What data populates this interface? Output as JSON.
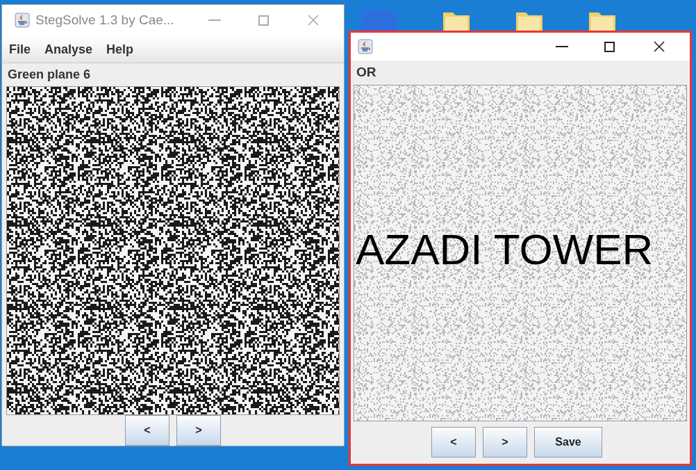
{
  "left_window": {
    "title": "StegSolve 1.3 by Cae...",
    "menu": [
      "File",
      "Analyse",
      "Help"
    ],
    "plane_label": "Green plane 6",
    "buttons": [
      "<",
      ">"
    ]
  },
  "right_window": {
    "plane_label": "OR",
    "image_text": "AZADI TOWER",
    "buttons": [
      "<",
      ">",
      "Save"
    ]
  }
}
